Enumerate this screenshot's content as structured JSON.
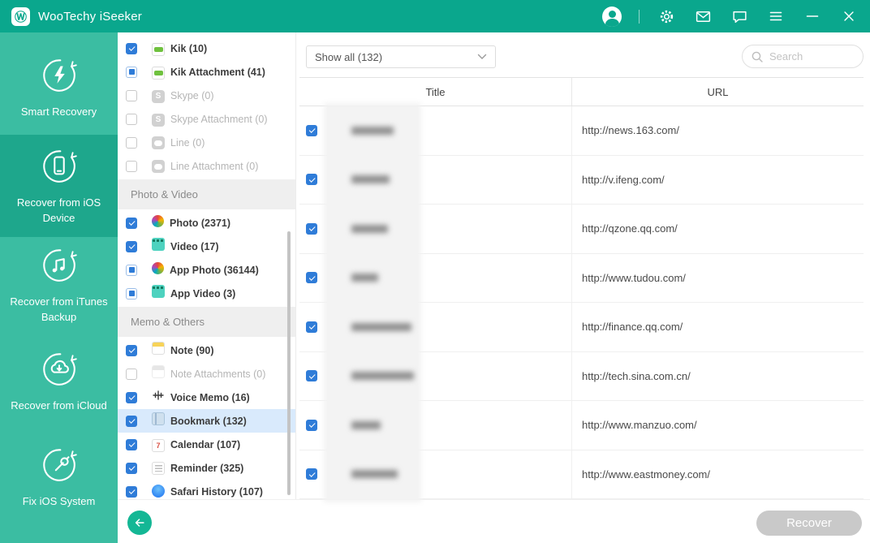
{
  "titlebar": {
    "app_title": "WooTechy iSeeker",
    "logo_glyph": "Ⓦ",
    "icons": [
      "user-account",
      "settings-gear",
      "mail",
      "feedback-chat",
      "menu",
      "minimize",
      "close"
    ]
  },
  "sidebar": {
    "items": [
      {
        "label": "Smart Recovery",
        "icon": "bolt",
        "active": false
      },
      {
        "label": "Recover from iOS Device",
        "icon": "phone",
        "active": true
      },
      {
        "label": "Recover from iTunes Backup",
        "icon": "music-note",
        "active": false
      },
      {
        "label": "Recover from iCloud",
        "icon": "cloud-download",
        "active": false
      },
      {
        "label": "Fix iOS System",
        "icon": "wrench",
        "active": false
      }
    ]
  },
  "data_types": {
    "entries": [
      {
        "kind": "item",
        "name": "Kik",
        "count": 10,
        "icon": "kik",
        "state": "checked",
        "disabled": false,
        "selected": false
      },
      {
        "kind": "item",
        "name": "Kik Attachment",
        "count": 41,
        "icon": "kik",
        "state": "indeterminate",
        "disabled": false,
        "selected": false
      },
      {
        "kind": "item",
        "name": "Skype",
        "count": 0,
        "icon": "skype",
        "state": "unchecked",
        "disabled": true,
        "selected": false
      },
      {
        "kind": "item",
        "name": "Skype Attachment",
        "count": 0,
        "icon": "skype",
        "state": "unchecked",
        "disabled": true,
        "selected": false
      },
      {
        "kind": "item",
        "name": "Line",
        "count": 0,
        "icon": "line",
        "state": "unchecked",
        "disabled": true,
        "selected": false
      },
      {
        "kind": "item",
        "name": "Line Attachment",
        "count": 0,
        "icon": "line",
        "state": "unchecked",
        "disabled": true,
        "selected": false
      },
      {
        "kind": "section",
        "name": "Photo & Video"
      },
      {
        "kind": "item",
        "name": "Photo",
        "count": 2371,
        "icon": "photo",
        "state": "checked",
        "disabled": false,
        "selected": false
      },
      {
        "kind": "item",
        "name": "Video",
        "count": 17,
        "icon": "video",
        "state": "checked",
        "disabled": false,
        "selected": false
      },
      {
        "kind": "item",
        "name": "App Photo",
        "count": 36144,
        "icon": "photo",
        "state": "indeterminate",
        "disabled": false,
        "selected": false
      },
      {
        "kind": "item",
        "name": "App Video",
        "count": 3,
        "icon": "video",
        "state": "indeterminate",
        "disabled": false,
        "selected": false
      },
      {
        "kind": "section",
        "name": "Memo & Others"
      },
      {
        "kind": "item",
        "name": "Note",
        "count": 90,
        "icon": "note",
        "state": "checked",
        "disabled": false,
        "selected": false
      },
      {
        "kind": "item",
        "name": "Note Attachments",
        "count": 0,
        "icon": "note",
        "state": "unchecked",
        "disabled": true,
        "selected": false
      },
      {
        "kind": "item",
        "name": "Voice Memo",
        "count": 16,
        "icon": "voice-memo",
        "state": "checked",
        "disabled": false,
        "selected": false
      },
      {
        "kind": "item",
        "name": "Bookmark",
        "count": 132,
        "icon": "bookmark",
        "state": "checked",
        "disabled": false,
        "selected": true
      },
      {
        "kind": "item",
        "name": "Calendar",
        "count": 107,
        "icon": "calendar",
        "state": "checked",
        "disabled": false,
        "selected": false
      },
      {
        "kind": "item",
        "name": "Reminder",
        "count": 325,
        "icon": "reminder",
        "state": "checked",
        "disabled": false,
        "selected": false
      },
      {
        "kind": "item",
        "name": "Safari History",
        "count": 107,
        "icon": "safari",
        "state": "checked",
        "disabled": false,
        "selected": false
      }
    ]
  },
  "main": {
    "filter_dropdown": {
      "value": "Show all (132)"
    },
    "search": {
      "placeholder": "Search"
    },
    "table": {
      "columns": [
        "Title",
        "URL"
      ],
      "rows": [
        {
          "checked": true,
          "title_redacted": true,
          "url": "http://news.163.com/"
        },
        {
          "checked": true,
          "title_redacted": true,
          "url": "http://v.ifeng.com/"
        },
        {
          "checked": true,
          "title_redacted": true,
          "url": "http://qzone.qq.com/"
        },
        {
          "checked": true,
          "title_redacted": true,
          "url": "http://www.tudou.com/"
        },
        {
          "checked": true,
          "title_redacted": true,
          "url": "http://finance.qq.com/"
        },
        {
          "checked": true,
          "title_redacted": true,
          "url": "http://tech.sina.com.cn/"
        },
        {
          "checked": true,
          "title_redacted": true,
          "url": "http://www.manzuo.com/"
        },
        {
          "checked": true,
          "title_redacted": true,
          "url": "http://www.eastmoney.com/"
        }
      ]
    },
    "footer": {
      "recover_label": "Recover",
      "recover_enabled": false
    }
  },
  "colors": {
    "titlebar_teal": "#0aa78d",
    "sidebar_teal": "#3bbda2",
    "sidebar_active_teal": "#1ea78c",
    "accent_green": "#14b795",
    "checkbox_blue": "#2f7cd8",
    "selected_row_blue": "#d9eafc",
    "disabled_gray": "#b5b5b5",
    "recover_disabled_gray": "#c9c9c9"
  }
}
